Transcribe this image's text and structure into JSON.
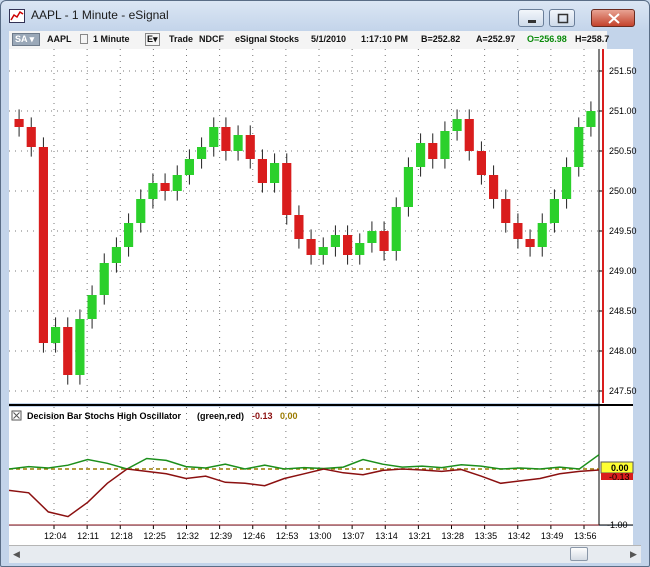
{
  "window": {
    "title": "AAPL - 1 Minute - eSignal",
    "icon": "esignal-app-icon",
    "buttons": [
      "minimize-icon",
      "maximize-icon",
      "close-icon"
    ]
  },
  "toolbar": {
    "symbol_link": "SA",
    "symbol": "AAPL",
    "interval": "1 Minute",
    "interval_menu": "E",
    "trade": "Trade",
    "exchange": "NDCF",
    "source": "eSignal Stocks",
    "date": "5/1/2010",
    "time": "1:17:10 PM",
    "quote_a": "B=252.82",
    "quote_b": "A=252.97",
    "quote_c": "O=256.98",
    "quote_d": "H=258.7"
  },
  "price_axis": {
    "ticks": [
      "251.50",
      "251.00",
      "250.50",
      "250.00",
      "249.50",
      "249.00",
      "248.50",
      "248.00",
      "247.50"
    ]
  },
  "indicator": {
    "name": "Decision Bar Stochs High Oscillator",
    "params": "(green,red)",
    "value_red": "-0.13",
    "value_yellow": "0.00",
    "axis_labels": [
      "-1.00"
    ],
    "current_badge": "0.00",
    "current_badge_red": "-0.13"
  },
  "time_axis": {
    "labels": [
      "12:04",
      "12:11",
      "12:18",
      "12:25",
      "12:32",
      "12:39",
      "12:46",
      "12:53",
      "13:00",
      "13:07",
      "13:14",
      "13:21",
      "13:28",
      "13:35",
      "13:42",
      "13:49",
      "13:56"
    ]
  },
  "colors": {
    "up_bar": "#2bd02b",
    "down_bar": "#d91d1d",
    "osc_green": "#1b8f1b",
    "osc_red": "#8b1010",
    "zero_line": "#9a7a00",
    "chart_bg": "#ffffff",
    "badge": "#ffff33"
  },
  "chart_data": [
    {
      "type": "candlestick",
      "title": "AAPL - 1 Minute",
      "ylim": [
        247.4,
        251.7
      ],
      "y_ticks": [
        251.5,
        251.0,
        250.5,
        250.0,
        249.5,
        249.0,
        248.5,
        248.0,
        247.5
      ],
      "x_labels": [
        "12:04",
        "12:11",
        "12:18",
        "12:25",
        "12:32",
        "12:39",
        "12:46",
        "12:53",
        "13:00",
        "13:07",
        "13:14",
        "13:21",
        "13:28",
        "13:35",
        "13:42",
        "13:49",
        "13:56"
      ],
      "closes": [
        250.8,
        250.55,
        248.1,
        248.3,
        247.7,
        248.4,
        248.7,
        249.1,
        249.3,
        249.6,
        249.9,
        250.1,
        250.0,
        250.2,
        250.4,
        250.55,
        250.8,
        250.5,
        250.7,
        250.4,
        250.1,
        250.35,
        249.7,
        249.4,
        249.2,
        249.3,
        249.45,
        249.2,
        249.35,
        249.5,
        249.25,
        249.8,
        250.3,
        250.6,
        250.4,
        250.75,
        250.9,
        250.5,
        250.2,
        249.9,
        249.6,
        249.4,
        249.3,
        249.6,
        249.9,
        250.3,
        250.8,
        251.0
      ]
    },
    {
      "type": "line",
      "title": "Decision Bar Stochs High Oscillator",
      "ylim": [
        -1.05,
        0.4
      ],
      "y_ticks": [
        0.0,
        -1.0
      ],
      "x_labels": [
        "12:04",
        "12:11",
        "12:18",
        "12:25",
        "12:32",
        "12:39",
        "12:46",
        "12:53",
        "13:00",
        "13:07",
        "13:14",
        "13:21",
        "13:28",
        "13:35",
        "13:42",
        "13:49",
        "13:56"
      ],
      "series": [
        {
          "name": "green",
          "values": [
            0.0,
            0.05,
            0.02,
            0.08,
            0.2,
            0.12,
            0.0,
            0.22,
            0.18,
            0.05,
            0.02,
            0.1,
            0.0,
            0.08,
            0.0,
            0.03,
            0.01,
            0.04,
            0.2,
            0.1,
            0.04,
            0.06,
            0.03,
            0.09,
            0.06,
            0.0,
            0.02,
            0.0,
            0.04,
            0.0,
            0.3
          ]
        },
        {
          "name": "red",
          "values": [
            -0.45,
            -0.5,
            -0.9,
            -1.0,
            -0.7,
            -0.3,
            0.0,
            -0.05,
            -0.1,
            -0.2,
            -0.15,
            -0.28,
            -0.3,
            -0.35,
            -0.2,
            -0.1,
            0.0,
            -0.08,
            -0.12,
            -0.03,
            0.0,
            -0.02,
            -0.05,
            -0.01,
            -0.15,
            -0.3,
            -0.25,
            -0.2,
            -0.1,
            -0.05,
            -0.02
          ]
        }
      ]
    }
  ]
}
